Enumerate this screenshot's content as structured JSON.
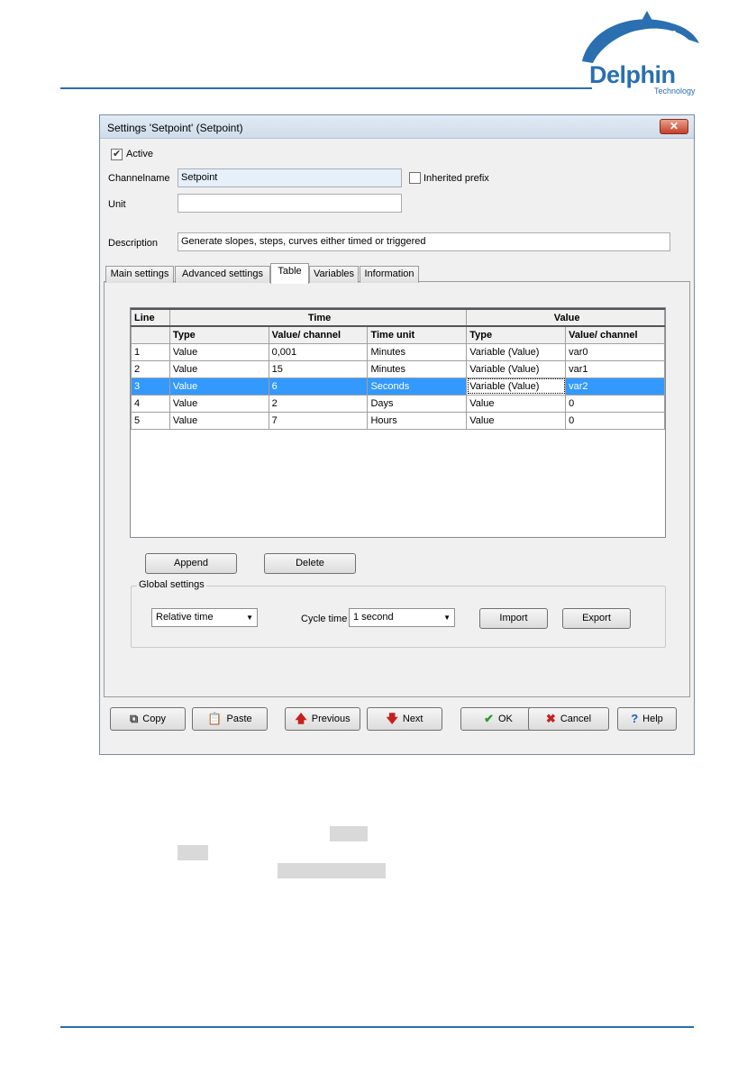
{
  "brand": {
    "word": "Delphin",
    "sub": "Technology",
    "color": "#2a6fb0"
  },
  "window": {
    "title": "Settings 'Setpoint' (Setpoint)",
    "close_symbol": "✕"
  },
  "form": {
    "active_label": "Active",
    "active_checked": true,
    "channelname_label": "Channelname",
    "channelname_value": "Setpoint",
    "inherited_prefix_label": "Inherited prefix",
    "unit_label": "Unit",
    "unit_value": "",
    "description_label": "Description",
    "description_value": "Generate slopes, steps, curves either timed or triggered"
  },
  "tabs": [
    {
      "label": "Main settings"
    },
    {
      "label": "Advanced settings"
    },
    {
      "label": "Table"
    },
    {
      "label": "Variables"
    },
    {
      "label": "Information"
    }
  ],
  "active_tab": "Table",
  "table": {
    "group_headers": {
      "line": "Line",
      "time": "Time",
      "value": "Value"
    },
    "columns": [
      "Type",
      "Value/ channel",
      "Time unit",
      "Type",
      "Value/ channel"
    ],
    "rows": [
      {
        "line": "1",
        "type": "Value",
        "time_value": "0,001",
        "time_unit": "Minutes",
        "value_type": "Variable (Value)",
        "value_channel": "var0"
      },
      {
        "line": "2",
        "type": "Value",
        "time_value": "15",
        "time_unit": "Minutes",
        "value_type": "Variable (Value)",
        "value_channel": "var1"
      },
      {
        "line": "3",
        "type": "Value",
        "time_value": "6",
        "time_unit": "Seconds",
        "value_type": "Variable (Value)",
        "value_channel": "var2"
      },
      {
        "line": "4",
        "type": "Value",
        "time_value": "2",
        "time_unit": "Days",
        "value_type": "Value",
        "value_channel": "0"
      },
      {
        "line": "5",
        "type": "Value",
        "time_value": "7",
        "time_unit": "Hours",
        "value_type": "Value",
        "value_channel": "0"
      }
    ],
    "selected_row": 3
  },
  "actions": {
    "append": "Append",
    "delete": "Delete"
  },
  "global_settings": {
    "legend": "Global settings",
    "time_mode": "Relative time",
    "cycle_time_label": "Cycle time",
    "cycle_time_value": "1 second",
    "import": "Import",
    "export": "Export"
  },
  "footer_buttons": {
    "copy": "Copy",
    "paste": "Paste",
    "previous": "Previous",
    "next": "Next",
    "ok": "OK",
    "cancel": "Cancel",
    "help": "Help"
  },
  "icons": {
    "copy": "copy-icon",
    "paste": "paste-icon",
    "previous": "arrow-up-icon",
    "next": "arrow-down-icon",
    "ok": "checkmark-icon",
    "cancel": "cross-icon",
    "help": "question-icon"
  },
  "colors": {
    "selection": "#3399ff",
    "ok_green": "#2e9b2e",
    "cancel_red": "#c62020",
    "arrow_red": "#c62020",
    "help_blue": "#2060c0"
  }
}
